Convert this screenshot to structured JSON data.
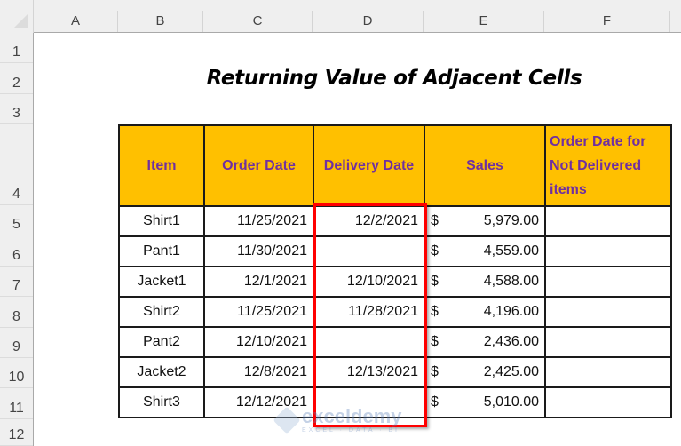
{
  "spreadsheet": {
    "columns": [
      "A",
      "B",
      "C",
      "D",
      "E",
      "F"
    ],
    "rows": [
      "1",
      "2",
      "3",
      "4",
      "5",
      "6",
      "7",
      "8",
      "9",
      "10",
      "11",
      "12"
    ]
  },
  "title": "Returning Value of Adjacent Cells",
  "table": {
    "headers": [
      "Item",
      "Order Date",
      "Delivery Date",
      "Sales",
      "Order Date for Not Delivered items"
    ],
    "rows": [
      {
        "item": "Shirt1",
        "order_date": "11/25/2021",
        "delivery_date": "12/2/2021",
        "currency": "$",
        "sales": "5,979.00",
        "result": ""
      },
      {
        "item": "Pant1",
        "order_date": "11/30/2021",
        "delivery_date": "",
        "currency": "$",
        "sales": "4,559.00",
        "result": ""
      },
      {
        "item": "Jacket1",
        "order_date": "12/1/2021",
        "delivery_date": "12/10/2021",
        "currency": "$",
        "sales": "4,588.00",
        "result": ""
      },
      {
        "item": "Shirt2",
        "order_date": "11/25/2021",
        "delivery_date": "11/28/2021",
        "currency": "$",
        "sales": "4,196.00",
        "result": ""
      },
      {
        "item": "Pant2",
        "order_date": "12/10/2021",
        "delivery_date": "",
        "currency": "$",
        "sales": "2,436.00",
        "result": ""
      },
      {
        "item": "Jacket2",
        "order_date": "12/8/2021",
        "delivery_date": "12/13/2021",
        "currency": "$",
        "sales": "2,425.00",
        "result": ""
      },
      {
        "item": "Shirt3",
        "order_date": "12/12/2021",
        "delivery_date": "",
        "currency": "$",
        "sales": "5,010.00",
        "result": ""
      }
    ]
  },
  "colors": {
    "header_fill": "#ffc000",
    "header_text": "#7030a0",
    "highlight_border": "#ff0000"
  },
  "watermark": {
    "name": "exceldemy",
    "tagline": "EXCEL · DATA · BI"
  }
}
